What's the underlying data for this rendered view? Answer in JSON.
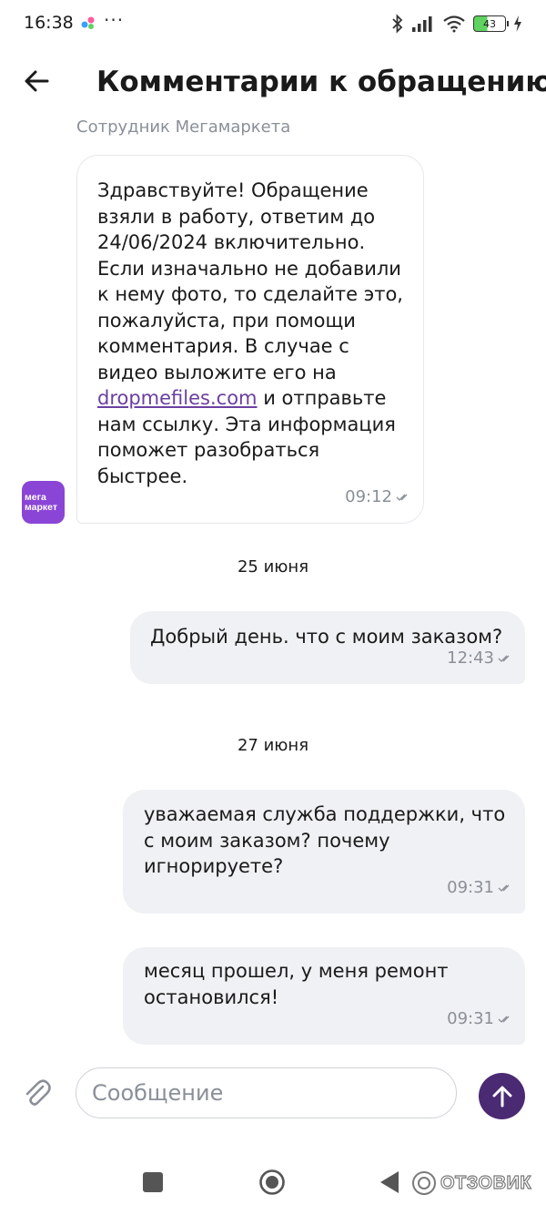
{
  "status_bar": {
    "time": "16:38",
    "more": "···",
    "battery": "43"
  },
  "header": {
    "title": "Комментарии к обращению"
  },
  "chat": {
    "sender_name": "Сотрудник Мегамаркета",
    "avatar_text": [
      "мега",
      "маркет"
    ],
    "incoming": {
      "text_before_link": "Здравствуйте! Обращение взяли в работу, ответим до 24/06/2024 включительно. Если изначально не добавили к нему фото, то сделайте это, пожалуйста, при помощи комментария. В случае с видео выложите его на ",
      "link": "dropmefiles.com",
      "text_after_link": " и отправьте нам ссылку. Эта информация поможет разобраться быстрее.",
      "time": "09:12"
    },
    "dates": [
      "25 июня",
      "27 июня"
    ],
    "outgoing": [
      {
        "text": "Добрый день. что с моим заказом?",
        "time": "12:43"
      },
      {
        "text": "уважаемая служба поддержки, что с моим заказом? почему игнорируете?",
        "time": "09:31"
      },
      {
        "text": "месяц прошел, у меня ремонт остановился!",
        "time": "09:31"
      }
    ]
  },
  "composer": {
    "placeholder": "Сообщение"
  },
  "watermark": {
    "text": "ОТЗОВИК"
  },
  "colors": {
    "brand_purple": "#8a45d6",
    "send_button": "#4a2a73",
    "link": "#6b3fa0",
    "outgoing_bubble": "#f0f1f4"
  },
  "icons": [
    "back-arrow-icon",
    "paperclip-icon",
    "send-arrow-icon",
    "read-check-icon",
    "bluetooth-icon",
    "signal-icon",
    "wifi-icon",
    "battery-icon",
    "charging-icon",
    "nav-recents-icon",
    "nav-home-icon",
    "nav-back-icon"
  ]
}
